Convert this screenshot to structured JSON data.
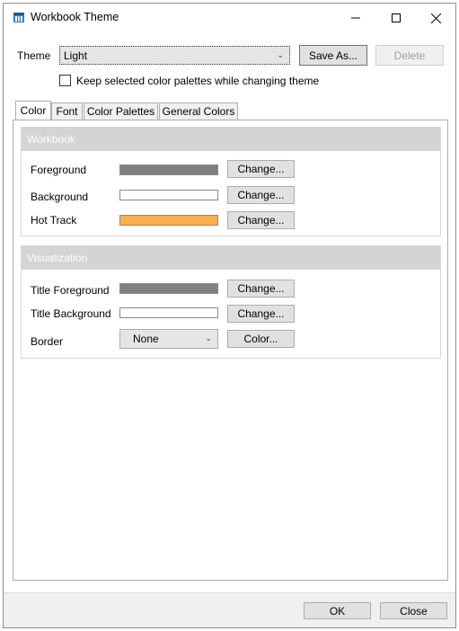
{
  "window": {
    "title": "Workbook Theme",
    "controls": {
      "minimize": "—",
      "maximize": "☐",
      "close": "✕"
    }
  },
  "theme": {
    "label": "Theme",
    "selected": "Light",
    "save_as": "Save As...",
    "delete": "Delete"
  },
  "keep_palettes": {
    "label": "Keep selected color palettes while changing theme",
    "checked": false
  },
  "tabs": [
    {
      "label": "Color",
      "active": true
    },
    {
      "label": "Font",
      "active": false
    },
    {
      "label": "Color Palettes",
      "active": false
    },
    {
      "label": "General Colors",
      "active": false
    }
  ],
  "workbook": {
    "header": "Workbook",
    "rows": [
      {
        "label": "Foreground",
        "color": "#808080",
        "button": "Change..."
      },
      {
        "label": "Background",
        "color": "#ffffff",
        "button": "Change..."
      },
      {
        "label": "Hot Track",
        "color": "#fbae4d",
        "button": "Change..."
      }
    ]
  },
  "visualization": {
    "header": "Visualization",
    "rows": [
      {
        "label": "Title Foreground",
        "color": "#808080",
        "button": "Change..."
      },
      {
        "label": "Title Background",
        "color": "#ffffff",
        "button": "Change..."
      }
    ],
    "border": {
      "label": "Border",
      "selected": "None",
      "button": "Color..."
    }
  },
  "footer": {
    "ok": "OK",
    "close": "Close"
  },
  "colors": {
    "accent_header": "#d4d4d4",
    "footer_bg": "#f0f0f0"
  }
}
